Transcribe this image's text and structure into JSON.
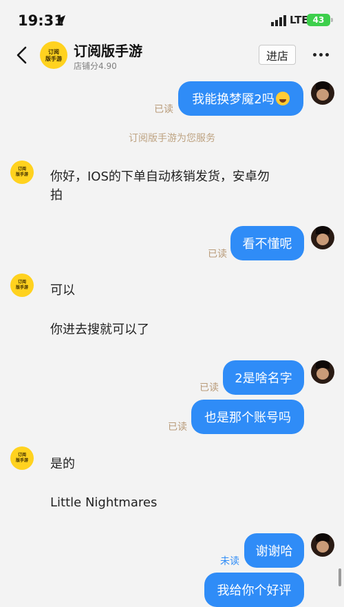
{
  "status_bar": {
    "time": "19:31",
    "network": "LTE",
    "battery": "43"
  },
  "header": {
    "shop_name": "订阅版手游",
    "shop_score": "店铺分4.90",
    "avatar_line1": "订阅",
    "avatar_line2": "版手游",
    "enter_store": "进店"
  },
  "chat": {
    "m1": "我能换梦魇2吗",
    "m1_status": "已读",
    "service_note": "订阅版手游为您服务",
    "m2_line1": "你好，IOS的下单自动核销发货，安卓勿",
    "m2_line2": "拍",
    "m3": "看不懂呢",
    "m3_status": "已读",
    "m4": "可以",
    "m5": "你进去搜就可以了",
    "m6": "2是啥名字",
    "m6_status": "已读",
    "m7": "也是那个账号吗",
    "m7_status": "已读",
    "m8": "是的",
    "m9": "Little Nightmares",
    "m10": "谢谢哈",
    "m10_status": "未读",
    "m11": "我给你个好评"
  }
}
